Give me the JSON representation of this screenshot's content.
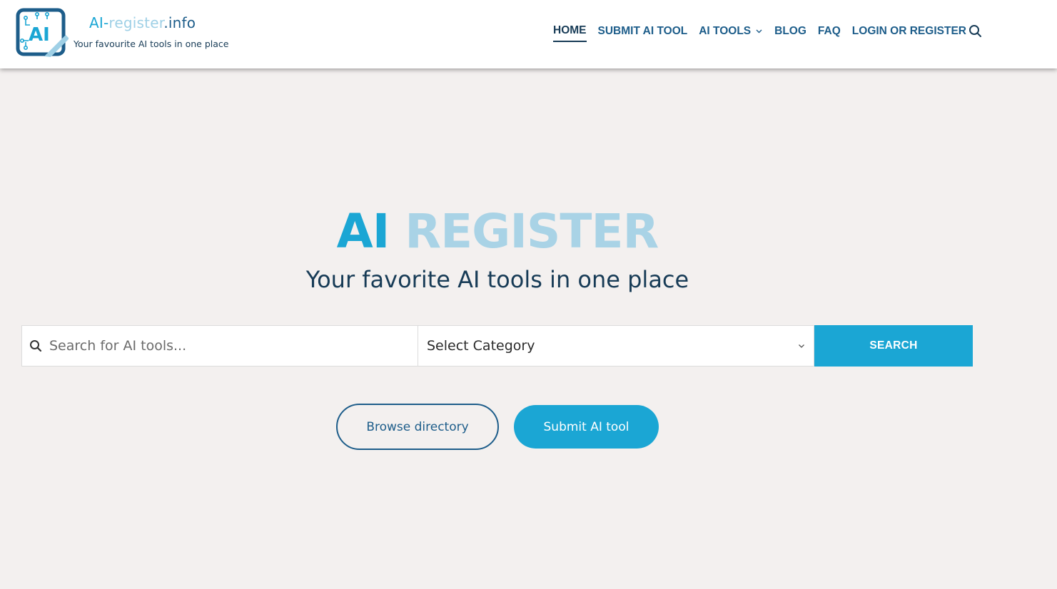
{
  "header": {
    "brand": {
      "part1": "AI-",
      "part2": "register",
      "part3": ".info",
      "logo_letters": "AI"
    },
    "tagline": "Your favourite AI tools in one place",
    "nav": [
      {
        "label": "HOME",
        "active": true
      },
      {
        "label": "SUBMIT AI TOOL"
      },
      {
        "label": "AI TOOLS",
        "has_dropdown": true
      },
      {
        "label": "BLOG"
      },
      {
        "label": "FAQ"
      },
      {
        "label": "LOGIN OR REGISTER"
      }
    ],
    "search_icon": "search-icon"
  },
  "hero": {
    "title_part1": "AI",
    "title_part2": "REGISTER",
    "subtitle": "Your favorite AI tools in one place"
  },
  "search": {
    "placeholder": "Search for AI tools...",
    "category_selected": "Select Category",
    "button_label": "SEARCH"
  },
  "actions": {
    "browse_label": "Browse directory",
    "submit_label": "Submit AI tool"
  },
  "colors": {
    "accent": "#1ba6d4",
    "accent_light": "#a9d3e6",
    "navy": "#1d5d8a",
    "text_dark": "#173b56",
    "background": "#f3f0ef"
  }
}
